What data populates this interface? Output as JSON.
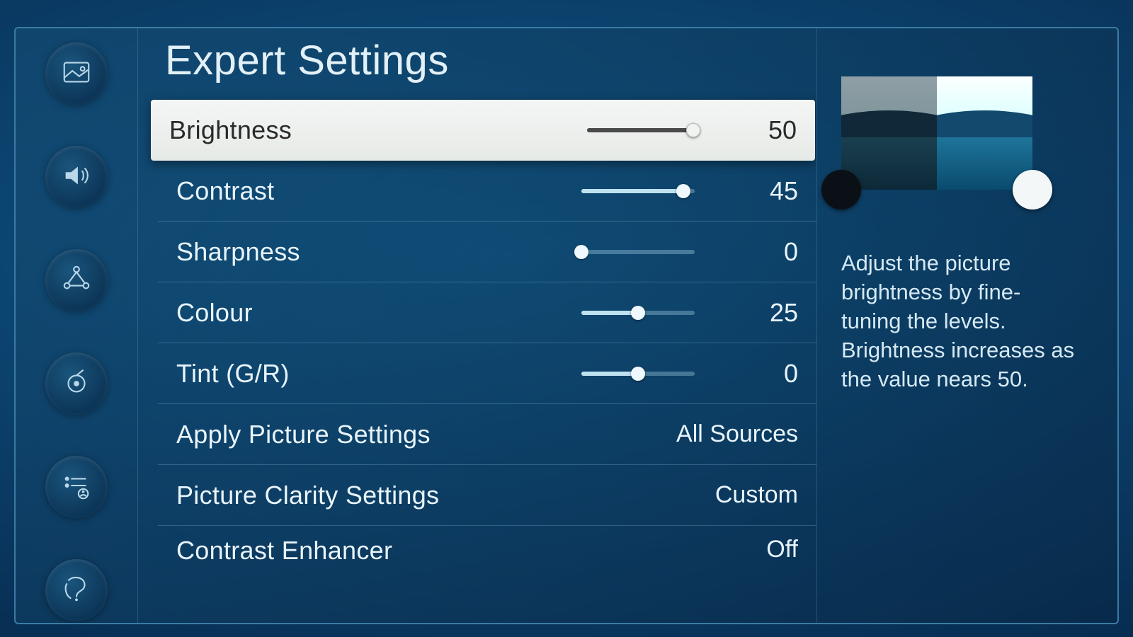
{
  "title": "Expert Settings",
  "sidebar": [
    {
      "name": "picture-icon"
    },
    {
      "name": "sound-icon"
    },
    {
      "name": "network-icon"
    },
    {
      "name": "broadcast-icon"
    },
    {
      "name": "list-icon"
    },
    {
      "name": "support-icon"
    }
  ],
  "rows": [
    {
      "key": "brightness",
      "label": "Brightness",
      "type": "slider",
      "value": 50,
      "pct": 100,
      "selected": true
    },
    {
      "key": "contrast",
      "label": "Contrast",
      "type": "slider",
      "value": 45,
      "pct": 90
    },
    {
      "key": "sharpness",
      "label": "Sharpness",
      "type": "slider",
      "value": 0,
      "pct": 0
    },
    {
      "key": "colour",
      "label": "Colour",
      "type": "slider",
      "value": 25,
      "pct": 50
    },
    {
      "key": "tint",
      "label": "Tint (G/R)",
      "type": "slider",
      "value": 0,
      "pct": 50
    },
    {
      "key": "apply",
      "label": "Apply Picture Settings",
      "type": "option",
      "option": "All Sources"
    },
    {
      "key": "clarity",
      "label": "Picture Clarity Settings",
      "type": "option",
      "option": "Custom"
    },
    {
      "key": "enhancer",
      "label": "Contrast Enhancer",
      "type": "option",
      "option": "Off",
      "partial": true
    }
  ],
  "info": {
    "description": "Adjust the picture brightness by fine-tuning the levels. Brightness increases as the value nears 50."
  }
}
